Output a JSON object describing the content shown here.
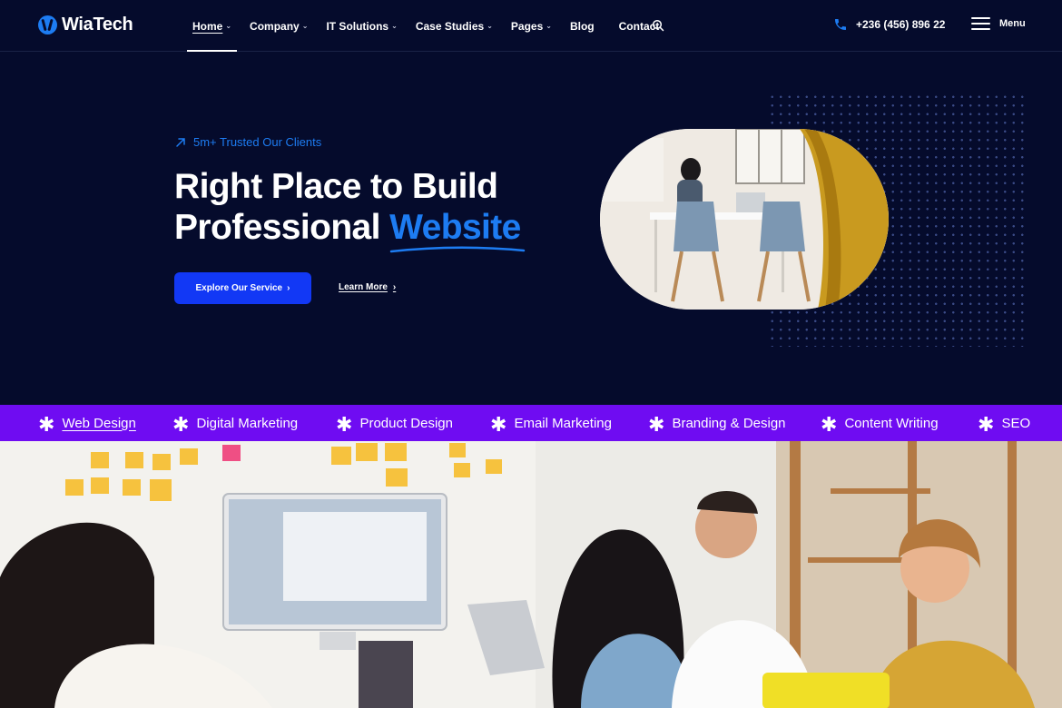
{
  "brand": {
    "name": "WiaTech",
    "accent": "#1d7cf2",
    "bg": "#050b2c",
    "marquee_bg": "#6f0cf2",
    "button_bg": "#1238f5"
  },
  "nav": {
    "items": [
      {
        "label": "Home",
        "dropdown": true,
        "active": true
      },
      {
        "label": "Company",
        "dropdown": true
      },
      {
        "label": "IT Solutions",
        "dropdown": true
      },
      {
        "label": "Case Studies",
        "dropdown": true
      },
      {
        "label": "Pages",
        "dropdown": true
      },
      {
        "label": "Blog",
        "dropdown": false
      },
      {
        "label": "Contact",
        "dropdown": false
      }
    ],
    "search_icon": "search-icon"
  },
  "header_right": {
    "phone": "+236 (456) 896 22",
    "menu_label": "Menu"
  },
  "hero": {
    "badge": "5m+ Trusted Our Clients",
    "title_line1": "Right Place to Build",
    "title_line2_prefix": "Professional",
    "title_highlight": "Website",
    "primary_button": "Explore Our Service",
    "secondary_link": "Learn More"
  },
  "marquee": {
    "items": [
      {
        "label": "Web Design",
        "active": true
      },
      {
        "label": "Digital Marketing"
      },
      {
        "label": "Product Design"
      },
      {
        "label": "Email Marketing"
      },
      {
        "label": "Branding & Design"
      },
      {
        "label": "Content Writing"
      },
      {
        "label": "SEO"
      }
    ]
  }
}
